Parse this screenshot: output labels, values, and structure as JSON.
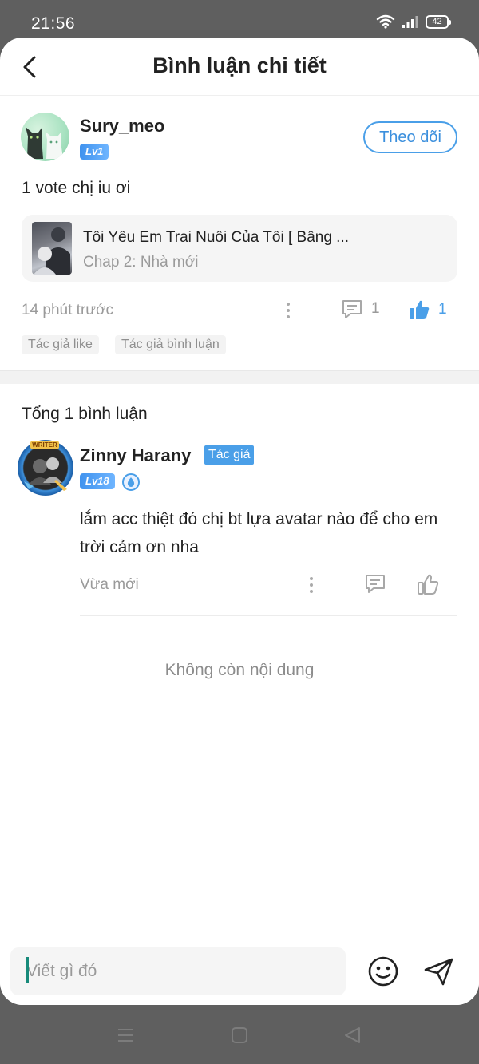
{
  "status_bar": {
    "time": "21:56",
    "battery": "42"
  },
  "header": {
    "title": "Bình luận chi tiết"
  },
  "post": {
    "username": "Sury_meo",
    "level": "Lv1",
    "follow_label": "Theo dõi",
    "text": "1 vote chị iu ơi",
    "story": {
      "title": "Tôi Yêu Em Trai Nuôi Của Tôi [ Bâng ...",
      "chapter": "Chap 2: Nhà mới"
    },
    "time": "14 phút trước",
    "comment_count": "1",
    "like_count": "1",
    "tags": [
      "Tác giả like",
      "Tác giả bình luận"
    ]
  },
  "replies_section": {
    "total_label": "Tổng 1 bình luận",
    "replies": [
      {
        "avatar_tag": "WRITER",
        "name": "Zinny Harany",
        "author_badge": "Tác giả",
        "level": "Lv18",
        "text": "lắm acc thiệt đó chị bt lựa avatar nào để cho em trời cảm ơn nha",
        "time": "Vừa mới"
      }
    ],
    "end_text": "Không còn nội dung"
  },
  "input_bar": {
    "placeholder": "Viết gì đó"
  },
  "colors": {
    "accent": "#4a9fe8",
    "muted_text": "#9a9a9a",
    "caret": "#178a7a"
  }
}
